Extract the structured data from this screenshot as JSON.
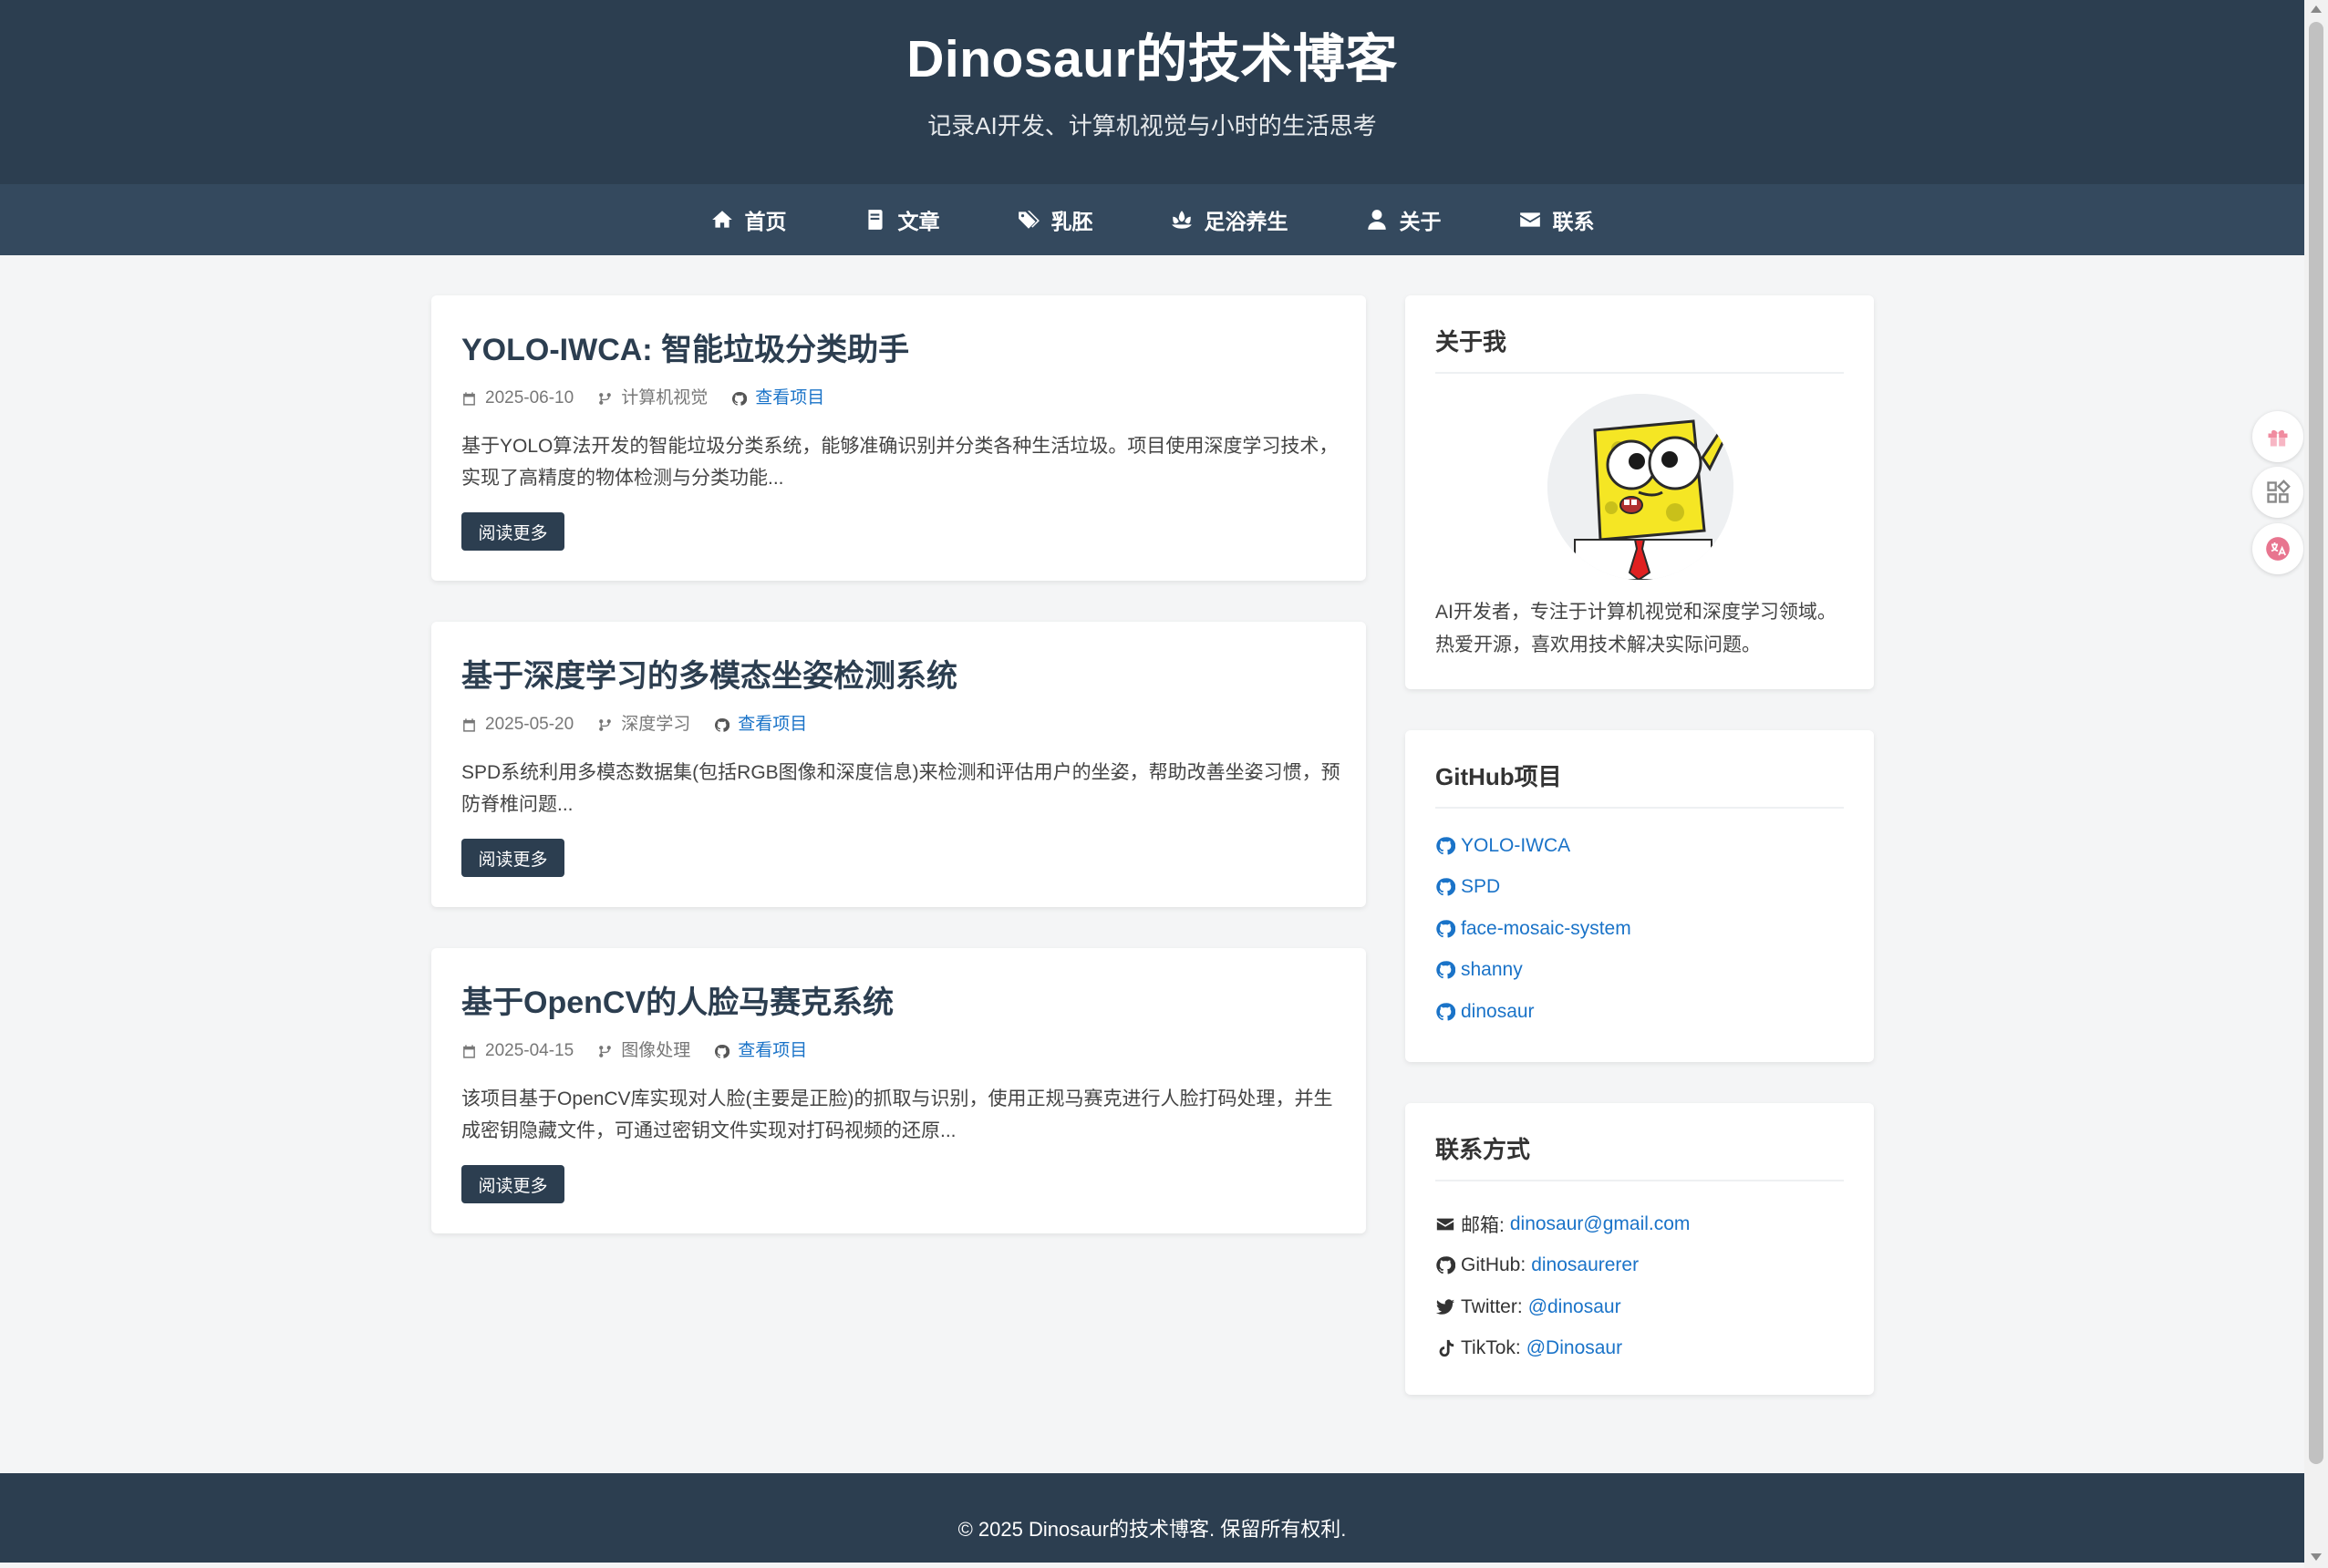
{
  "header": {
    "title": "Dinosaur的技术博客",
    "subtitle": "记录AI开发、计算机视觉与小时的生活思考"
  },
  "nav": {
    "items": [
      {
        "label": "首页",
        "icon": "home-icon"
      },
      {
        "label": "文章",
        "icon": "book-icon"
      },
      {
        "label": "乳胚",
        "icon": "tags-icon"
      },
      {
        "label": "足浴养生",
        "icon": "lotus-icon"
      },
      {
        "label": "关于",
        "icon": "user-icon"
      },
      {
        "label": "联系",
        "icon": "envelope-icon"
      }
    ]
  },
  "posts": [
    {
      "title": "YOLO-IWCA: 智能垃圾分类助手",
      "date": "2025-06-10",
      "category": "计算机视觉",
      "link_label": "查看项目",
      "excerpt": "基于YOLO算法开发的智能垃圾分类系统，能够准确识别并分类各种生活垃圾。项目使用深度学习技术，实现了高精度的物体检测与分类功能...",
      "read_more": "阅读更多"
    },
    {
      "title": "基于深度学习的多模态坐姿检测系统",
      "date": "2025-05-20",
      "category": "深度学习",
      "link_label": "查看项目",
      "excerpt": "SPD系统利用多模态数据集(包括RGB图像和深度信息)来检测和评估用户的坐姿，帮助改善坐姿习惯，预防脊椎问题...",
      "read_more": "阅读更多"
    },
    {
      "title": "基于OpenCV的人脸马赛克系统",
      "date": "2025-04-15",
      "category": "图像处理",
      "link_label": "查看项目",
      "excerpt": "该项目基于OpenCV库实现对人脸(主要是正脸)的抓取与识别，使用正规马赛克进行人脸打码处理，并生成密钥隐藏文件，可通过密钥文件实现对打码视频的还原...",
      "read_more": "阅读更多"
    }
  ],
  "sidebar": {
    "about": {
      "title": "关于我",
      "text": "AI开发者，专注于计算机视觉和深度学习领域。热爱开源，喜欢用技术解决实际问题。"
    },
    "github": {
      "title": "GitHub项目",
      "repos": [
        "YOLO-IWCA",
        "SPD",
        "face-mosaic-system",
        "shanny",
        "dinosaur"
      ]
    },
    "contact": {
      "title": "联系方式",
      "items": [
        {
          "label": "邮箱:",
          "value": "dinosaur@gmail.com",
          "icon": "envelope-icon"
        },
        {
          "label": "GitHub:",
          "value": "dinosaurerer",
          "icon": "github-icon"
        },
        {
          "label": "Twitter:",
          "value": "@dinosaur",
          "icon": "twitter-icon"
        },
        {
          "label": "TikTok:",
          "value": "@Dinosaur",
          "icon": "tiktok-icon"
        }
      ]
    }
  },
  "footer": {
    "text": "© 2025 Dinosaur的技术博客. 保留所有权利."
  },
  "colors": {
    "header_bg": "#2c3e50",
    "nav_bg": "#34495e",
    "link": "#1a73c8",
    "page_bg": "#f4f5f6"
  }
}
